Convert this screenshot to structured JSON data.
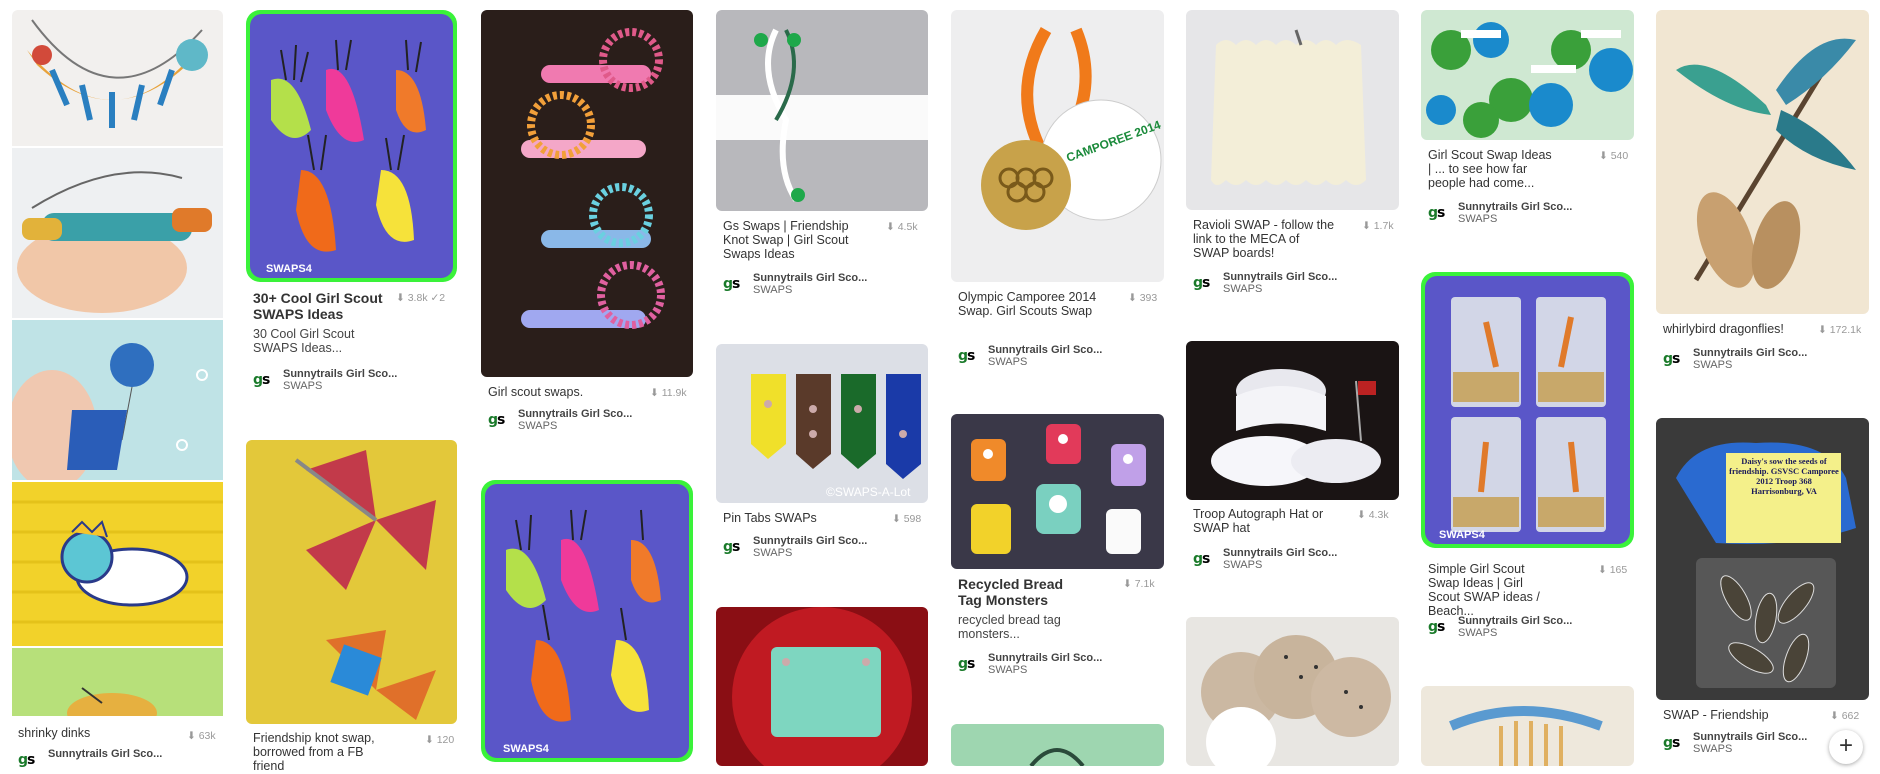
{
  "owner": "Sunnytrails Girl Sco...",
  "board": "SWAPS",
  "pins": [
    {
      "title": "shrinky dinks",
      "stats": "63k"
    },
    {
      "title": "30+ Cool Girl Scout SWAPS Ideas",
      "stats": "3.8k  ✓2",
      "desc": "30 Cool Girl Scout SWAPS Ideas..."
    },
    {
      "title": "Friendship knot swap, borrowed from a FB friend",
      "stats": "120"
    },
    {
      "title": "Girl scout swaps.",
      "stats": "11.9k"
    },
    {
      "title": "Gs Swaps | Friendship Knot Swap | Girl Scout Swaps Ideas",
      "stats": "4.5k"
    },
    {
      "title": "Pin Tabs SWAPs",
      "stats": "598"
    },
    {
      "title": "Olympic Camporee 2014 Swap. Girl Scouts Swap",
      "stats": "393"
    },
    {
      "title": "Recycled Bread Tag Monsters",
      "stats": "7.1k",
      "desc": "recycled bread tag monsters..."
    },
    {
      "title": "Ravioli SWAP - follow the link to the MECA of SWAP boards!",
      "stats": "1.7k"
    },
    {
      "title": "Troop Autograph Hat or SWAP hat",
      "stats": "4.3k"
    },
    {
      "title": "Girl Scout Swap Ideas | ... to see how far people had come...",
      "stats": "540"
    },
    {
      "title": "Simple Girl Scout Swap Ideas | Girl Scout SWAP ideas / Beach...",
      "stats": "165"
    },
    {
      "title": "whirlybird dragonflies!",
      "stats": "172.1k"
    },
    {
      "title": "SWAP - Friendship",
      "stats": "662"
    }
  ],
  "image_text": {
    "swaps4": "SWAPS4",
    "swaps_a_lot": "©SWAPS-A-Lot",
    "camporee": "CAMPOREE 2014",
    "sign": "Daisy's sow the seeds of friendship. GSVSC Camporee 2012 Troop 368 Harrisonburg, VA"
  },
  "add_button": "+"
}
